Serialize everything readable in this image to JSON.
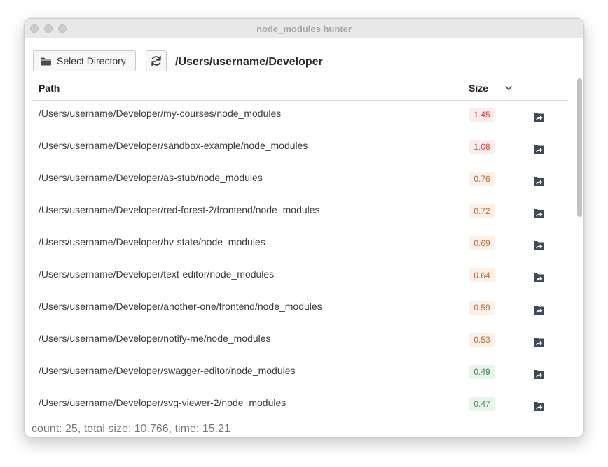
{
  "window": {
    "title": "node_modules hunter"
  },
  "toolbar": {
    "select_label": "Select Directory",
    "folder_icon": "folder-icon",
    "refresh_icon": "refresh-icon",
    "current_dir": "/Users/username/Developer"
  },
  "table": {
    "headers": {
      "path": "Path",
      "size": "Size"
    },
    "rows": [
      {
        "path": "/Users/username/Developer/my-courses/node_modules",
        "size": "1.45",
        "level": "red"
      },
      {
        "path": "/Users/username/Developer/sandbox-example/node_modules",
        "size": "1.08",
        "level": "red"
      },
      {
        "path": "/Users/username/Developer/as-stub/node_modules",
        "size": "0.76",
        "level": "orange"
      },
      {
        "path": "/Users/username/Developer/red-forest-2/frontend/node_modules",
        "size": "0.72",
        "level": "orange"
      },
      {
        "path": "/Users/username/Developer/bv-state/node_modules",
        "size": "0.69",
        "level": "orange"
      },
      {
        "path": "/Users/username/Developer/text-editor/node_modules",
        "size": "0.64",
        "level": "orange"
      },
      {
        "path": "/Users/username/Developer/another-one/frontend/node_modules",
        "size": "0.59",
        "level": "orange"
      },
      {
        "path": "/Users/username/Developer/notify-me/node_modules",
        "size": "0.53",
        "level": "orange"
      },
      {
        "path": "/Users/username/Developer/swagger-editor/node_modules",
        "size": "0.49",
        "level": "green"
      },
      {
        "path": "/Users/username/Developer/svg-viewer-2/node_modules",
        "size": "0.47",
        "level": "green"
      }
    ]
  },
  "status": {
    "text": "count: 25, total size: 10.766, time: 15.21"
  },
  "colors": {
    "red": "#c1484f",
    "orange": "#b46a3a",
    "green": "#3d8a52"
  }
}
